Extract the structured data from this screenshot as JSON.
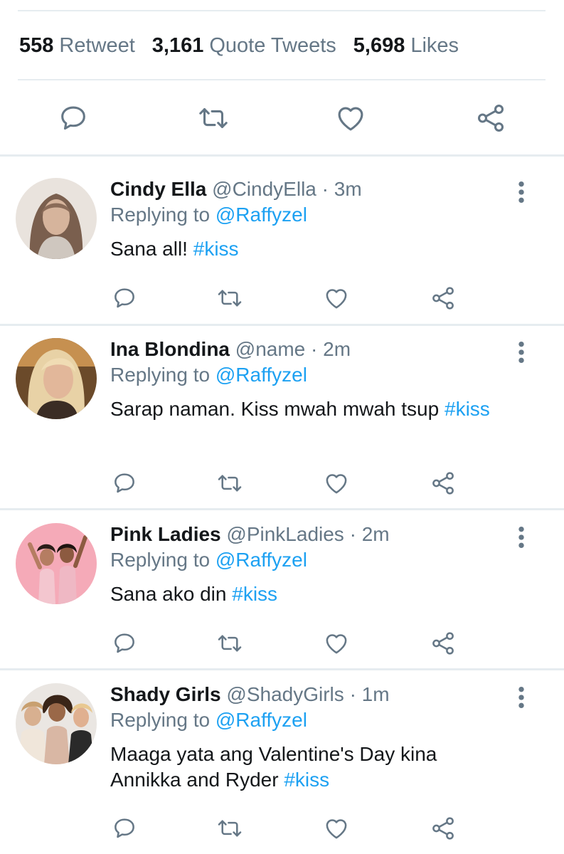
{
  "stats": {
    "retweets_count": "558",
    "retweets_label": "Retweet",
    "quotes_count": "3,161",
    "quotes_label": "Quote Tweets",
    "likes_count": "5,698",
    "likes_label": "Likes"
  },
  "icons": {
    "reply": "speech-bubble-icon",
    "retweet": "retweet-arrows-icon",
    "like": "heart-icon",
    "share": "share-nodes-icon",
    "more": "vertical-dots-icon"
  },
  "colors": {
    "link": "#1da1f2",
    "muted": "#657786",
    "text": "#14171a",
    "divider": "#e6ecf0"
  },
  "replies": [
    {
      "name": "Cindy Ella",
      "handle": "@CindyElla",
      "time": "· 3m",
      "replying_to_label": "Replying to",
      "mention": "@Raffyzel",
      "text": "Sana all!",
      "hashtag": "#kiss"
    },
    {
      "name": "Ina Blondina",
      "handle": "@name",
      "time": "· 2m",
      "replying_to_label": "Replying to",
      "mention": "@Raffyzel",
      "text": "Sarap naman. Kiss mwah mwah tsup",
      "hashtag": "#kiss"
    },
    {
      "name": "Pink Ladies",
      "handle": "@PinkLadies",
      "time": "· 2m",
      "replying_to_label": "Replying to",
      "mention": "@Raffyzel",
      "text": "Sana ako din",
      "hashtag": "#kiss"
    },
    {
      "name": "Shady Girls",
      "handle": "@ShadyGirls",
      "time": "· 1m",
      "replying_to_label": "Replying to",
      "mention": "@Raffyzel",
      "text": "Maaga yata ang Valentine's Day kina Annikka and Ryder",
      "hashtag": "#kiss"
    }
  ]
}
